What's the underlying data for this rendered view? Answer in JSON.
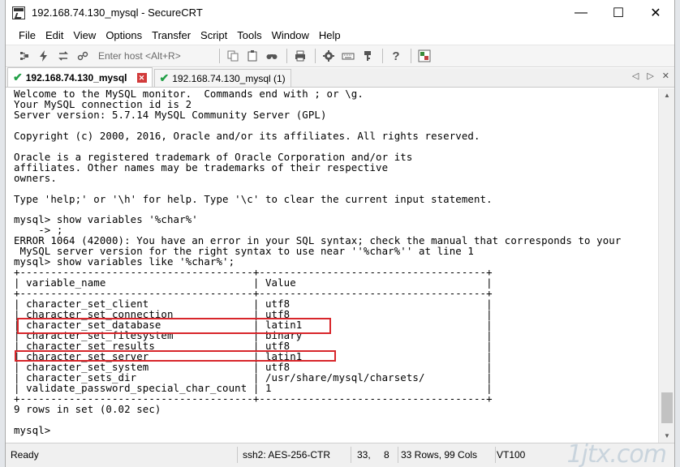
{
  "window": {
    "title": "192.168.74.130_mysql - SecureCRT",
    "minimize": "—",
    "maximize": "☐",
    "close": "✕"
  },
  "menu": [
    {
      "id": "file",
      "label": "File"
    },
    {
      "id": "edit",
      "label": "Edit"
    },
    {
      "id": "view",
      "label": "View"
    },
    {
      "id": "options",
      "label": "Options"
    },
    {
      "id": "transfer",
      "label": "Transfer"
    },
    {
      "id": "script",
      "label": "Script"
    },
    {
      "id": "tools",
      "label": "Tools"
    },
    {
      "id": "window",
      "label": "Window"
    },
    {
      "id": "help",
      "label": "Help"
    }
  ],
  "toolbar": {
    "host_placeholder": "Enter host <Alt+R>",
    "icons": [
      "connect-icon",
      "quick-connect-icon",
      "reconnect-icon",
      "disconnect-icon",
      "copy-icon",
      "paste-icon",
      "find-icon",
      "print-icon",
      "settings-icon",
      "keymap-icon",
      "key-icon",
      "help-icon",
      "sftp-icon"
    ]
  },
  "tabs": [
    {
      "label": "192.168.74.130_mysql",
      "active": true,
      "status": "connected"
    },
    {
      "label": "192.168.74.130_mysql (1)",
      "active": false,
      "status": "connected"
    }
  ],
  "terminal": {
    "lines": [
      "Welcome to the MySQL monitor.  Commands end with ; or \\g.",
      "Your MySQL connection id is 2",
      "Server version: 5.7.14 MySQL Community Server (GPL)",
      "",
      "Copyright (c) 2000, 2016, Oracle and/or its affiliates. All rights reserved.",
      "",
      "Oracle is a registered trademark of Oracle Corporation and/or its",
      "affiliates. Other names may be trademarks of their respective",
      "owners.",
      "",
      "Type 'help;' or '\\h' for help. Type '\\c' to clear the current input statement.",
      "",
      "mysql> show variables '%char%'",
      "    -> ;",
      "ERROR 1064 (42000): You have an error in your SQL syntax; check the manual that corresponds to your",
      " MySQL server version for the right syntax to use near ''%char%'' at line 1",
      "mysql> show variables like '%char%';",
      "+--------------------------------------+-------------------------------------+",
      "| variable_name                        | Value                               |",
      "+--------------------------------------+-------------------------------------+",
      "| character_set_client                 | utf8                                |",
      "| character_set_connection             | utf8                                |",
      "| character_set_database               | latin1                              |",
      "| character_set_filesystem             | binary                              |",
      "| character_set_results                | utf8                                |",
      "| character_set_server                 | latin1                              |",
      "| character_set_system                 | utf8                                |",
      "| character_sets_dir                   | /usr/share/mysql/charsets/          |",
      "| validate_password_special_char_count | 1                                   |",
      "+--------------------------------------+-------------------------------------+",
      "9 rows in set (0.02 sec)",
      "",
      "mysql> "
    ]
  },
  "status": {
    "state": "Ready",
    "protocol": "ssh2: AES-256-CTR",
    "cursor_row": "33,",
    "cursor_col": "8",
    "size": "33 Rows, 99 Cols",
    "terminal_type": "VT100",
    "watermark": "1jtx.com"
  },
  "colors": {
    "highlight": "#d8262b",
    "connected": "#23a047"
  }
}
